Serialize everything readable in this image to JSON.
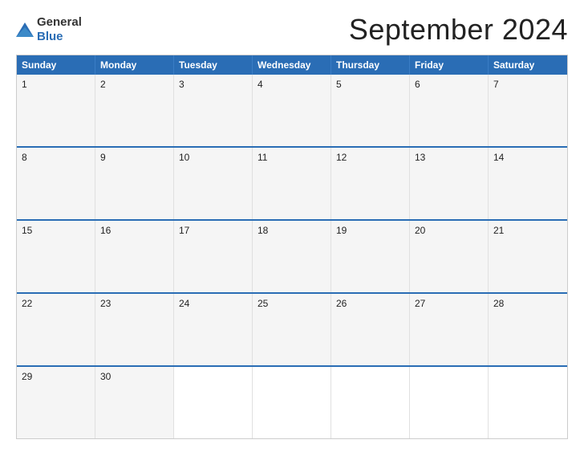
{
  "logo": {
    "text_general": "General",
    "text_blue": "Blue"
  },
  "calendar": {
    "title": "September 2024",
    "day_headers": [
      "Sunday",
      "Monday",
      "Tuesday",
      "Wednesday",
      "Thursday",
      "Friday",
      "Saturday"
    ],
    "weeks": [
      [
        {
          "day": "1",
          "empty": false
        },
        {
          "day": "2",
          "empty": false
        },
        {
          "day": "3",
          "empty": false
        },
        {
          "day": "4",
          "empty": false
        },
        {
          "day": "5",
          "empty": false
        },
        {
          "day": "6",
          "empty": false
        },
        {
          "day": "7",
          "empty": false
        }
      ],
      [
        {
          "day": "8",
          "empty": false
        },
        {
          "day": "9",
          "empty": false
        },
        {
          "day": "10",
          "empty": false
        },
        {
          "day": "11",
          "empty": false
        },
        {
          "day": "12",
          "empty": false
        },
        {
          "day": "13",
          "empty": false
        },
        {
          "day": "14",
          "empty": false
        }
      ],
      [
        {
          "day": "15",
          "empty": false
        },
        {
          "day": "16",
          "empty": false
        },
        {
          "day": "17",
          "empty": false
        },
        {
          "day": "18",
          "empty": false
        },
        {
          "day": "19",
          "empty": false
        },
        {
          "day": "20",
          "empty": false
        },
        {
          "day": "21",
          "empty": false
        }
      ],
      [
        {
          "day": "22",
          "empty": false
        },
        {
          "day": "23",
          "empty": false
        },
        {
          "day": "24",
          "empty": false
        },
        {
          "day": "25",
          "empty": false
        },
        {
          "day": "26",
          "empty": false
        },
        {
          "day": "27",
          "empty": false
        },
        {
          "day": "28",
          "empty": false
        }
      ],
      [
        {
          "day": "29",
          "empty": false
        },
        {
          "day": "30",
          "empty": false
        },
        {
          "day": "",
          "empty": true
        },
        {
          "day": "",
          "empty": true
        },
        {
          "day": "",
          "empty": true
        },
        {
          "day": "",
          "empty": true
        },
        {
          "day": "",
          "empty": true
        }
      ]
    ]
  }
}
